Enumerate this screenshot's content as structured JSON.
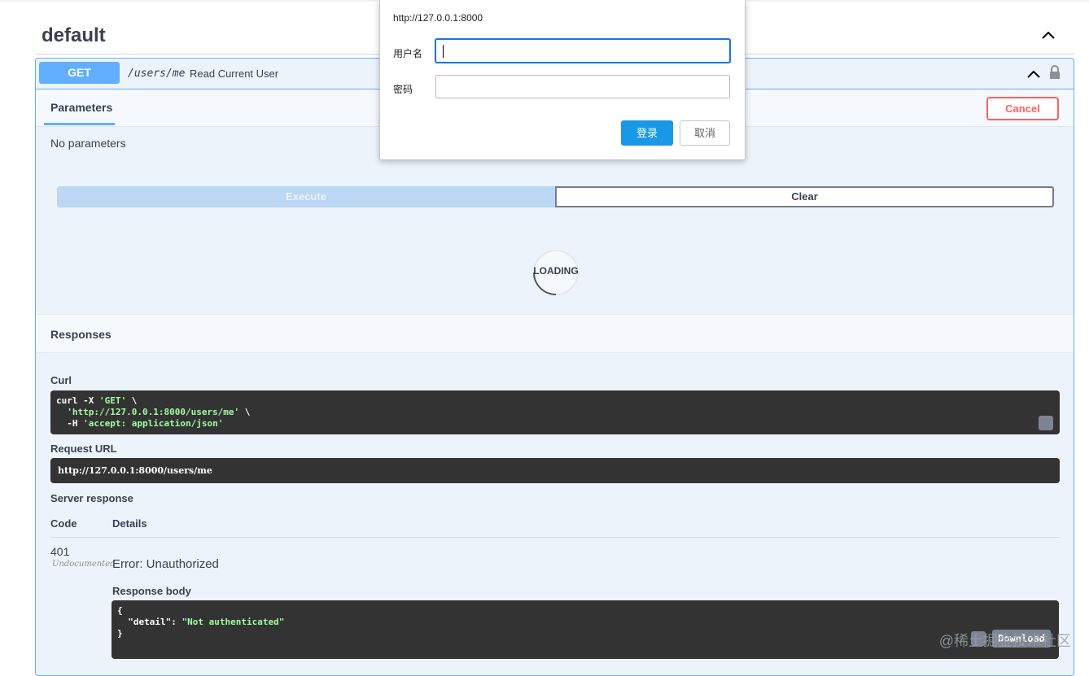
{
  "tag": {
    "title": "default"
  },
  "operation": {
    "method": "GET",
    "path": "/users/me",
    "summary": "Read Current User"
  },
  "parameters": {
    "tab_label": "Parameters",
    "cancel_label": "Cancel",
    "empty_text": "No parameters"
  },
  "actions": {
    "execute_label": "Execute",
    "clear_label": "Clear"
  },
  "loading": {
    "text": "LOADING"
  },
  "responses": {
    "title": "Responses",
    "curl_label": "Curl",
    "curl_lines": [
      {
        "cmd": "curl -X ",
        "str": "'GET'",
        "tail": " \\"
      },
      {
        "cmd": "  ",
        "str": "'http://127.0.0.1:8000/users/me'",
        "tail": " \\"
      },
      {
        "cmd": "  -H ",
        "str": "'accept: application/json'",
        "tail": ""
      }
    ],
    "request_url_label": "Request URL",
    "request_url": "http://127.0.0.1:8000/users/me",
    "server_response_label": "Server response",
    "code_header": "Code",
    "details_header": "Details",
    "code": "401",
    "undocumented": "Undocumented",
    "error_text": "Error: Unauthorized",
    "response_body_label": "Response body",
    "body_lines": [
      {
        "text": "{",
        "key": "",
        "str": ""
      },
      {
        "text": "  ",
        "key": "\"detail\"",
        "str": "\"Not authenticated\""
      },
      {
        "text": "}",
        "key": "",
        "str": ""
      }
    ],
    "download_label": "Download"
  },
  "watermark": "@稀土掘金技术社区",
  "dialog": {
    "url": "http://127.0.0.1:8000",
    "username_label": "用户名",
    "username_value": "",
    "password_label": "密码",
    "password_value": "",
    "login_label": "登录",
    "cancel_label": "取消"
  },
  "colors": {
    "get_accent": "#61affe",
    "cancel_red": "#ff6060",
    "code_bg": "#333333",
    "login_blue": "#1a98e8"
  }
}
